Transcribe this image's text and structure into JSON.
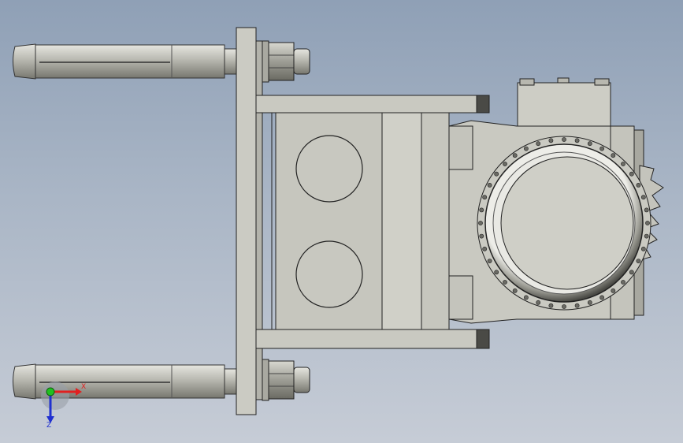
{
  "app": {
    "view": "cad-3d-viewport"
  },
  "viewport": {
    "background_top": "#8fa0b6",
    "background_bottom": "#c6ccd6"
  },
  "model": {
    "part_color": "#c9c9c1",
    "edge_color": "#2a2a2a",
    "dark_part_color": "#5a5a55"
  },
  "triad": {
    "x_label": "X",
    "z_label": "Z",
    "x_color": "#e02020",
    "z_color": "#2030d0",
    "origin_color": "#20c020"
  }
}
